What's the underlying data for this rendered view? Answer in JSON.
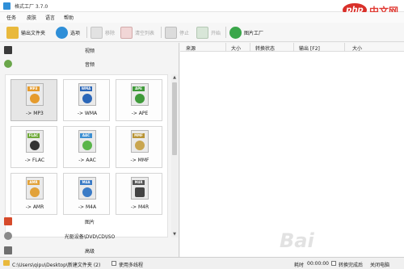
{
  "app": {
    "title": "格式工厂 3.7.0"
  },
  "menu": [
    "任务",
    "皮肤",
    "语言",
    "帮助"
  ],
  "toolbar": {
    "output_folder": "输出文件夹",
    "options": "选项",
    "remove": "移除",
    "clear_list": "清空列表",
    "stop": "停止",
    "start": "开始",
    "factory": "图片工厂"
  },
  "categories": {
    "video": "视频",
    "audio": "音频",
    "image": "图片",
    "disc": "光驱设备\\DVD\\CD\\ISO",
    "advanced": "高级"
  },
  "formats": [
    {
      "label": "-> MP3",
      "tag": "MP3",
      "color": "#e59b2d",
      "icon": "mp3-icon"
    },
    {
      "label": "-> WMA",
      "tag": "WMA",
      "color": "#2a66b8",
      "icon": "wma-icon"
    },
    {
      "label": "-> APE",
      "tag": "APE",
      "color": "#3f9a3a",
      "icon": "ape-icon"
    },
    {
      "label": "-> FLAC",
      "tag": "FLAC",
      "color": "#6fa93a",
      "icon": "flac-icon"
    },
    {
      "label": "-> AAC",
      "tag": "AAC",
      "color": "#3c8fd2",
      "icon": "aac-icon"
    },
    {
      "label": "-> MMF",
      "tag": "MMF",
      "color": "#b89436",
      "icon": "mmf-icon"
    },
    {
      "label": "-> AMR",
      "tag": "AMR",
      "color": "#e2a23a",
      "icon": "amr-icon"
    },
    {
      "label": "-> M4A",
      "tag": "M4A",
      "color": "#3a7bc6",
      "icon": "m4a-icon"
    },
    {
      "label": "-> M4R",
      "tag": "M4R",
      "color": "#555555",
      "icon": "m4r-icon"
    }
  ],
  "columns": [
    "来源",
    "大小",
    "转换状态",
    "输出 [F2]",
    "大小"
  ],
  "status": {
    "path": "C:\\Users\\qipu\\Desktop\\新建文件夹 (2)",
    "multithread": "使用多线程",
    "elapsed_label": "耗时",
    "elapsed_value": "00:00:00",
    "after_label": "转换完成后",
    "after_value": "关闭电脑"
  },
  "watermark": "Bai",
  "badge": {
    "brand": "php",
    "text": "中文网"
  },
  "colors": {
    "accent": "#2f8fd8",
    "badge": "#d9302a"
  }
}
